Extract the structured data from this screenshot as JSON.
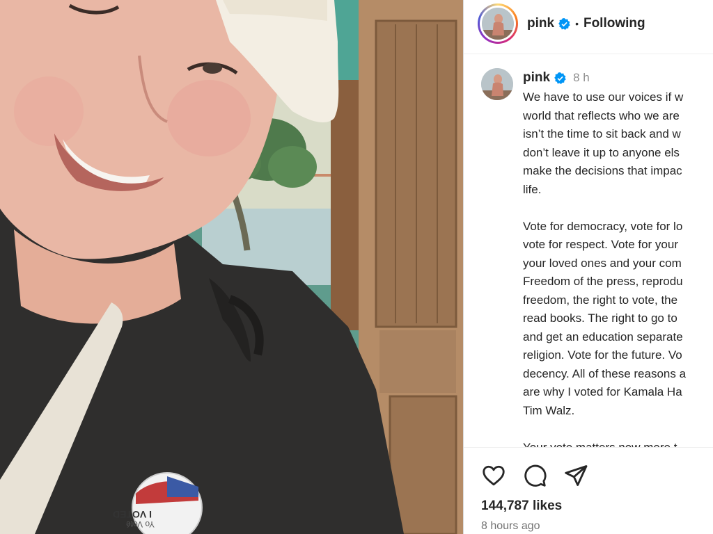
{
  "post": {
    "photo_description_icon": "selfie-photo",
    "sticker_text_1": "I VOTED",
    "sticker_text_2": "Yo Voté"
  },
  "header": {
    "username": "pink",
    "separator": "•",
    "follow_status": "Following",
    "verified_icon": "verified-badge-icon",
    "verified_color": "#0095f6"
  },
  "caption": {
    "username": "pink",
    "time": "8 h",
    "text": "We have to use our voices if w\nworld that reflects who we are\nisn’t the time to sit back and w\ndon’t leave it up to anyone els\nmake the decisions that impac\nlife.\n\nVote for democracy, vote for lo\nvote for respect. Vote for your\nyour loved ones and your com\nFreedom of the press, reprodu\nfreedom, the right to vote, the\nread books. The right to go to\nand get an education separate\nreligion. Vote for the future. Vo\ndecency. All of these reasons a\nare why I voted for Kamala Ha\nTim Walz.\n\nYour vote matters now more t"
  },
  "actions": {
    "like_icon": "heart-icon",
    "comment_icon": "comment-icon",
    "share_icon": "share-icon",
    "likes": "144,787 likes",
    "posted": "8 hours ago"
  }
}
